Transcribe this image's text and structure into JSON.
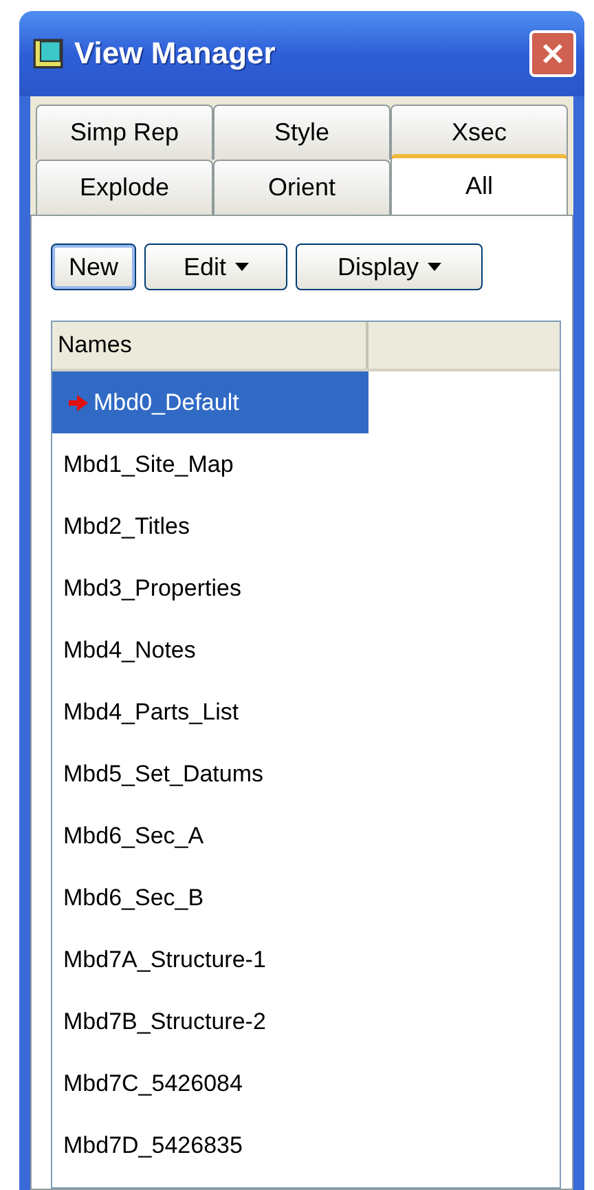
{
  "window": {
    "title": "View Manager"
  },
  "tab_rows": [
    [
      {
        "label": "Simp Rep",
        "selected": false
      },
      {
        "label": "Style",
        "selected": false
      },
      {
        "label": "Xsec",
        "selected": false
      }
    ],
    [
      {
        "label": "Explode",
        "selected": false
      },
      {
        "label": "Orient",
        "selected": false
      },
      {
        "label": "All",
        "selected": true
      }
    ]
  ],
  "buttons": [
    {
      "label": "New",
      "has_menu": false,
      "focused": true
    },
    {
      "label": "Edit",
      "has_menu": true,
      "focused": false
    },
    {
      "label": "Display",
      "has_menu": true,
      "focused": false
    }
  ],
  "list": {
    "columns": [
      "Names"
    ],
    "rows": [
      {
        "name": "Mbd0_Default",
        "selected": true,
        "active": true
      },
      {
        "name": "Mbd1_Site_Map",
        "selected": false,
        "active": false
      },
      {
        "name": "Mbd2_Titles",
        "selected": false,
        "active": false
      },
      {
        "name": "Mbd3_Properties",
        "selected": false,
        "active": false
      },
      {
        "name": "Mbd4_Notes",
        "selected": false,
        "active": false
      },
      {
        "name": "Mbd4_Parts_List",
        "selected": false,
        "active": false
      },
      {
        "name": "Mbd5_Set_Datums",
        "selected": false,
        "active": false
      },
      {
        "name": "Mbd6_Sec_A",
        "selected": false,
        "active": false
      },
      {
        "name": "Mbd6_Sec_B",
        "selected": false,
        "active": false
      },
      {
        "name": "Mbd7A_Structure-1",
        "selected": false,
        "active": false
      },
      {
        "name": "Mbd7B_Structure-2",
        "selected": false,
        "active": false
      },
      {
        "name": "Mbd7C_5426084",
        "selected": false,
        "active": false
      },
      {
        "name": "Mbd7D_5426835",
        "selected": false,
        "active": false
      }
    ]
  }
}
